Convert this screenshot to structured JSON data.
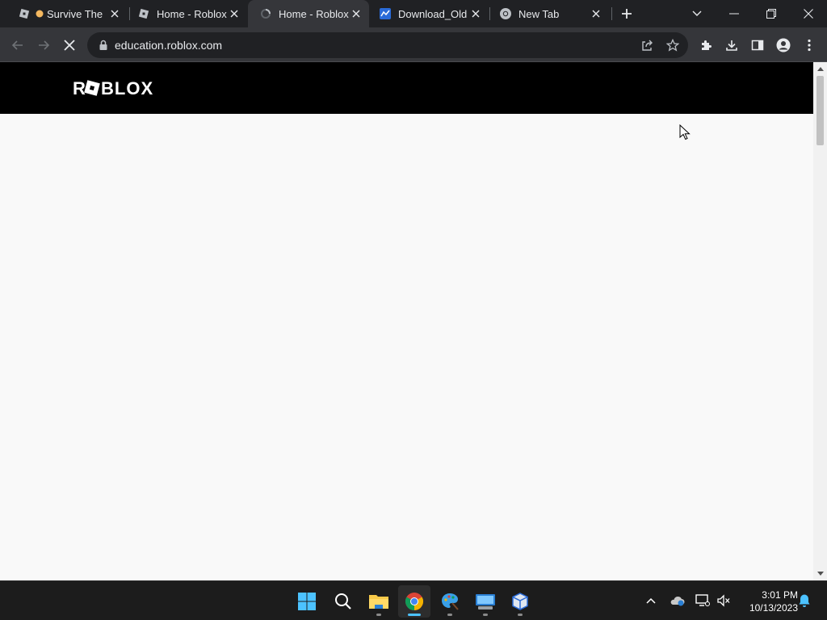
{
  "browser": {
    "tabs": [
      {
        "title": "Survive The",
        "icon": "roblox-icon"
      },
      {
        "title": "Home - Roblox",
        "icon": "roblox-icon"
      },
      {
        "title": "Home - Roblox",
        "icon": "loading-icon",
        "active": true
      },
      {
        "title": "Download_Old",
        "icon": "document-icon"
      },
      {
        "title": "New Tab",
        "icon": "chrome-icon"
      }
    ],
    "address": "education.roblox.com"
  },
  "page": {
    "logo_text": "ROBLOX"
  },
  "taskbar": {
    "time": "3:01 PM",
    "date": "10/13/2023"
  },
  "colors": {
    "tabstrip": "#202124",
    "toolbar": "#35363a",
    "page_bg": "#f9f9f9",
    "header_bg": "#000000",
    "taskbar": "#1c1c1c",
    "taskbar_accent": "#4cc2ff"
  }
}
